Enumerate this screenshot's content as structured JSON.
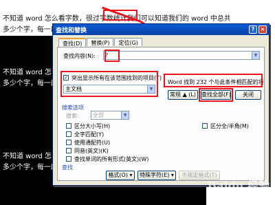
{
  "document": {
    "lines": [
      "不知道 word 怎么看字数，很过字数统计我们可以知道我们的 word 中总共有多少字符或者",
      "多少个字，每一段有多少字符，总共 word 中有多少行字母"
    ],
    "repeat_lines": [
      "不知道 word 怎么看",
      "多少个字，每一段"
    ],
    "repeat_lines_2": [
      "不知道 word 怎么看",
      "多少个字，每一段"
    ]
  },
  "dialog": {
    "title": "查找和替换",
    "help_symbol": "?",
    "close_symbol": "×",
    "tabs": [
      "查找(D)",
      "替换(P)",
      "定位(G)"
    ],
    "find_label": "查找内容(N):",
    "find_value": "?",
    "highlight_label": "突出显示所有在该范围找到的项目(T)",
    "scope_value": "主文档",
    "result_text": "Word 找到 232 个与此条件相匹配的项",
    "more_label": "常规 ▲ (L)",
    "find_all_label": "查找全部(F)",
    "close_label": "关闭",
    "search_options_title": "搜索选项",
    "search_label": "搜索:",
    "search_value": "全部",
    "options": [
      "区分大小写(H)",
      "全字匹配(Y)",
      "使用通配符(U)",
      "同音(英文)(K)",
      "查找单词的所有形式(英文)(W)"
    ],
    "option_right": "区分全/半角(M)",
    "find_section_title": "查找",
    "format_label": "格式(O) ▾",
    "special_label": "特殊字符(E) ▾",
    "no_format_label": "不限定格式(T)"
  },
  "watermark": {
    "text": "Baidu 经验",
    "sub": "jingyan.baidu.com"
  },
  "colors": {
    "annotation": "#e8141e",
    "titlebar": "#0b5bd6",
    "dialog_bg": "#ece9d8"
  }
}
